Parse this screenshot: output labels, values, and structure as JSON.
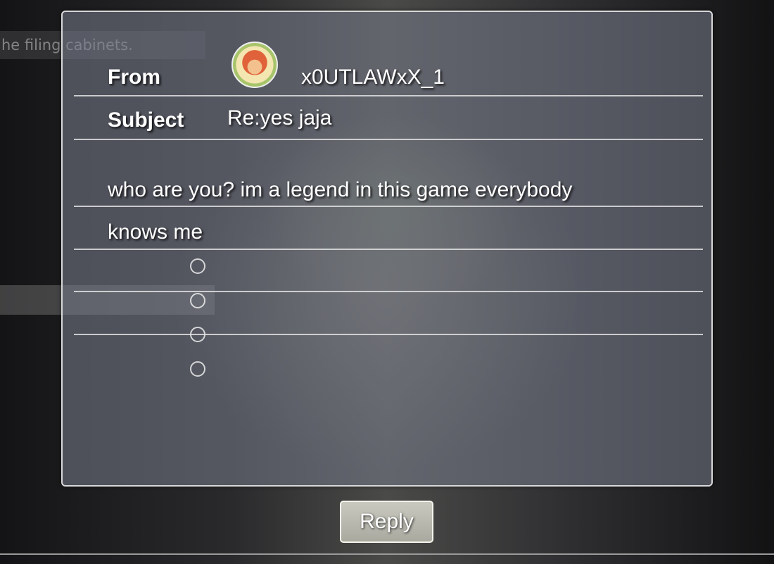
{
  "background": {
    "caption": "he filing cabinets."
  },
  "mail": {
    "from_label": "From",
    "sender": "x0UTLAWxX_1",
    "subject_label": "Subject",
    "subject": "Re:yes jaja",
    "body_lines": [
      "who are you? im a legend in this game everybody",
      "knows me"
    ]
  },
  "actions": {
    "reply_label": "Reply"
  },
  "colors": {
    "panel_border": "#d8d8d8",
    "text": "#ffffff",
    "button_face": "#b9b9b0"
  }
}
